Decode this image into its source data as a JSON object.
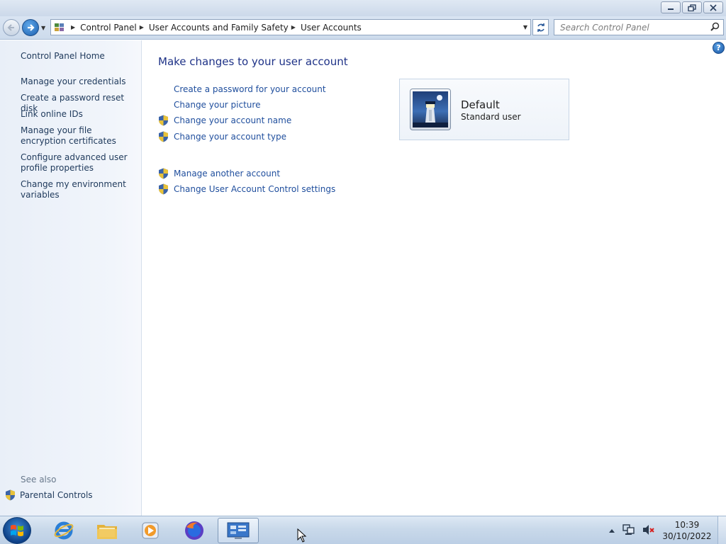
{
  "window": {
    "controls": {
      "minimize": "▭",
      "restore": "🗗",
      "close": "✕"
    }
  },
  "nav": {
    "breadcrumbs": [
      "Control Panel",
      "User Accounts and Family Safety",
      "User Accounts"
    ],
    "search_placeholder": "Search Control Panel"
  },
  "sidebar": {
    "home": "Control Panel Home",
    "items": [
      {
        "label": "Manage your credentials"
      },
      {
        "label": "Create a password reset disk"
      },
      {
        "label": "Link online IDs"
      },
      {
        "label": "Manage your file encryption certificates"
      },
      {
        "label": "Configure advanced user profile properties"
      },
      {
        "label": "Change my environment variables"
      }
    ],
    "see_also": "See also",
    "parental_controls": "Parental Controls"
  },
  "main": {
    "heading": "Make changes to your user account",
    "tasks": [
      {
        "label": "Create a password for your account",
        "shield": false
      },
      {
        "label": "Change your picture",
        "shield": false
      },
      {
        "label": "Change your account name",
        "shield": true
      },
      {
        "label": "Change your account type",
        "shield": true
      }
    ],
    "other_tasks": [
      {
        "label": "Manage another account",
        "shield": true
      },
      {
        "label": "Change User Account Control settings",
        "shield": true
      }
    ],
    "account": {
      "name": "Default",
      "type": "Standard user"
    }
  },
  "taskbar": {
    "apps": [
      "internet-explorer",
      "windows-explorer",
      "media-player",
      "firefox",
      "control-panel"
    ],
    "active_app": "control-panel",
    "time": "10:39",
    "date": "30/10/2022"
  },
  "colors": {
    "link": "#1f4e9d",
    "heading": "#1e3287",
    "sidebar_text": "#1e395b"
  }
}
